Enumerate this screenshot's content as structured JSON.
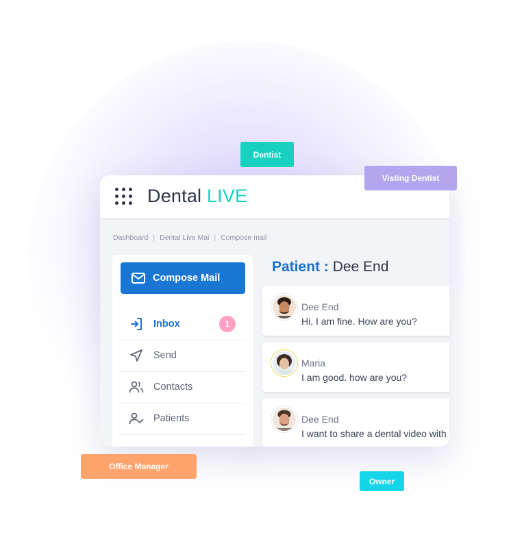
{
  "brand": {
    "name": "Dental",
    "live": "LIVE"
  },
  "breadcrumb": [
    "Dashboard",
    "Dental Live Mai",
    "Compose mail"
  ],
  "sidebar": {
    "compose_label": "Compose Mail",
    "items": [
      {
        "label": "Inbox",
        "icon": "inbox-icon",
        "active": true,
        "badge": "1"
      },
      {
        "label": "Send",
        "icon": "send-icon"
      },
      {
        "label": "Contacts",
        "icon": "contacts-icon"
      },
      {
        "label": "Patients",
        "icon": "patients-icon"
      }
    ]
  },
  "conversation": {
    "label": "Patient :",
    "name": "Dee End",
    "messages": [
      {
        "sender": "Dee End",
        "text": "Hi, I am fine. How are you?"
      },
      {
        "sender": "Maria",
        "text": "I am good. how are you?"
      },
      {
        "sender": "Dee End",
        "text": "I want to share a dental video with"
      }
    ]
  },
  "tags": {
    "dentist": "Dentist",
    "visiting_dentist": "Visting Dentist",
    "office_manager": "Office Manager",
    "owner": "Owner"
  },
  "colors": {
    "accent": "#1976d2",
    "live": "#17d0c0",
    "badge": "#ff9fc3",
    "tag_dentist": "#17d0c0",
    "tag_visiting": "#b3a6ee",
    "tag_office": "#ffa46c",
    "tag_owner": "#15d6e8"
  }
}
